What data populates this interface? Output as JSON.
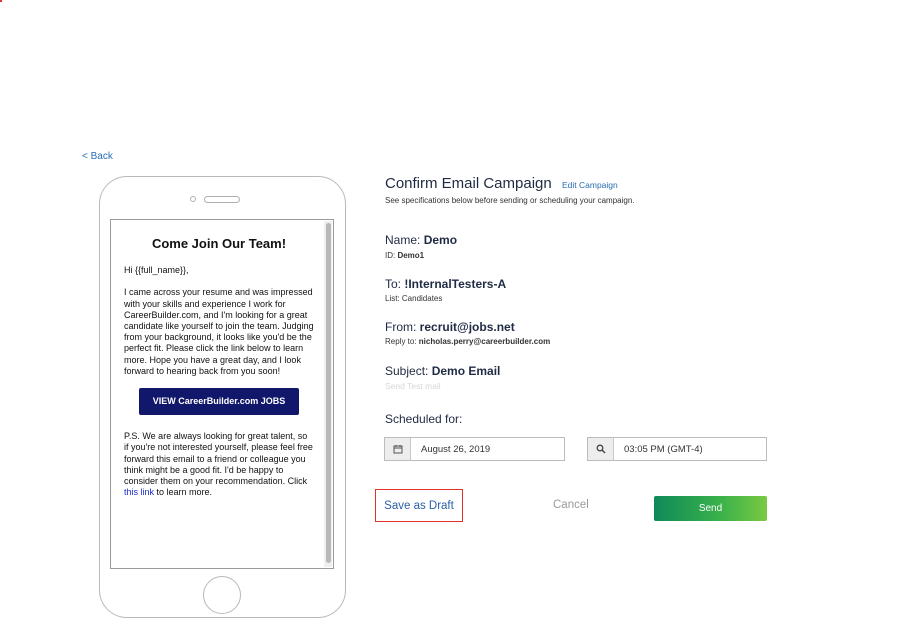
{
  "back_label": "< Back",
  "preview": {
    "title": "Come Join Our Team!",
    "greeting": "Hi {{full_name}},",
    "body": "I came across your resume and was impressed with your skills and experience I work for CareerBuilder.com, and I'm looking for a great candidate like yourself to join the team. Judging from your background, it looks like you'd be the perfect fit. Please click the link below to learn more. Hope you have a great day, and I look forward to hearing back from you soon!",
    "cta_label": "VIEW CareerBuilder.com JOBS",
    "ps_before_link": "P.S. We are always looking for great talent, so if you're not interested yourself, please feel free forward this email to a friend or colleague you think might be a good fit. I'd be happy to consider them on your recommendation. Click ",
    "ps_link": "this link",
    "ps_after_link": " to learn more."
  },
  "campaign": {
    "title": "Confirm Email Campaign",
    "edit_label": "Edit Campaign",
    "subtitle": "See specifications below before sending or scheduling your campaign.",
    "name_label": "Name: ",
    "name_value": "Demo",
    "id_label": "ID: ",
    "id_value": "Demo1",
    "to_label": "To: ",
    "to_value": "!InternalTesters-A",
    "list_label": "List: ",
    "list_value": "Candidates",
    "from_label": "From: ",
    "from_value": "recruit@jobs.net",
    "reply_label": "Reply to: ",
    "reply_value": "nicholas.perry@careerbuilder.com",
    "subject_label": "Subject: ",
    "subject_value": "Demo Email",
    "send_test_label": "Send Test mail"
  },
  "schedule": {
    "label": "Scheduled for:",
    "date_value": "August 26, 2019",
    "date_icon": "calendar-icon",
    "time_value": "03:05 PM (GMT-4)",
    "time_icon": "search-icon"
  },
  "actions": {
    "draft_label": "Save as Draft",
    "cancel_label": "Cancel",
    "send_label": "Send"
  },
  "colors": {
    "link": "#2a6db3",
    "cta_bg": "#11186b",
    "highlight_border": "#e3312a",
    "send_gradient_start": "#0f8a58",
    "send_gradient_end": "#7ac943"
  }
}
